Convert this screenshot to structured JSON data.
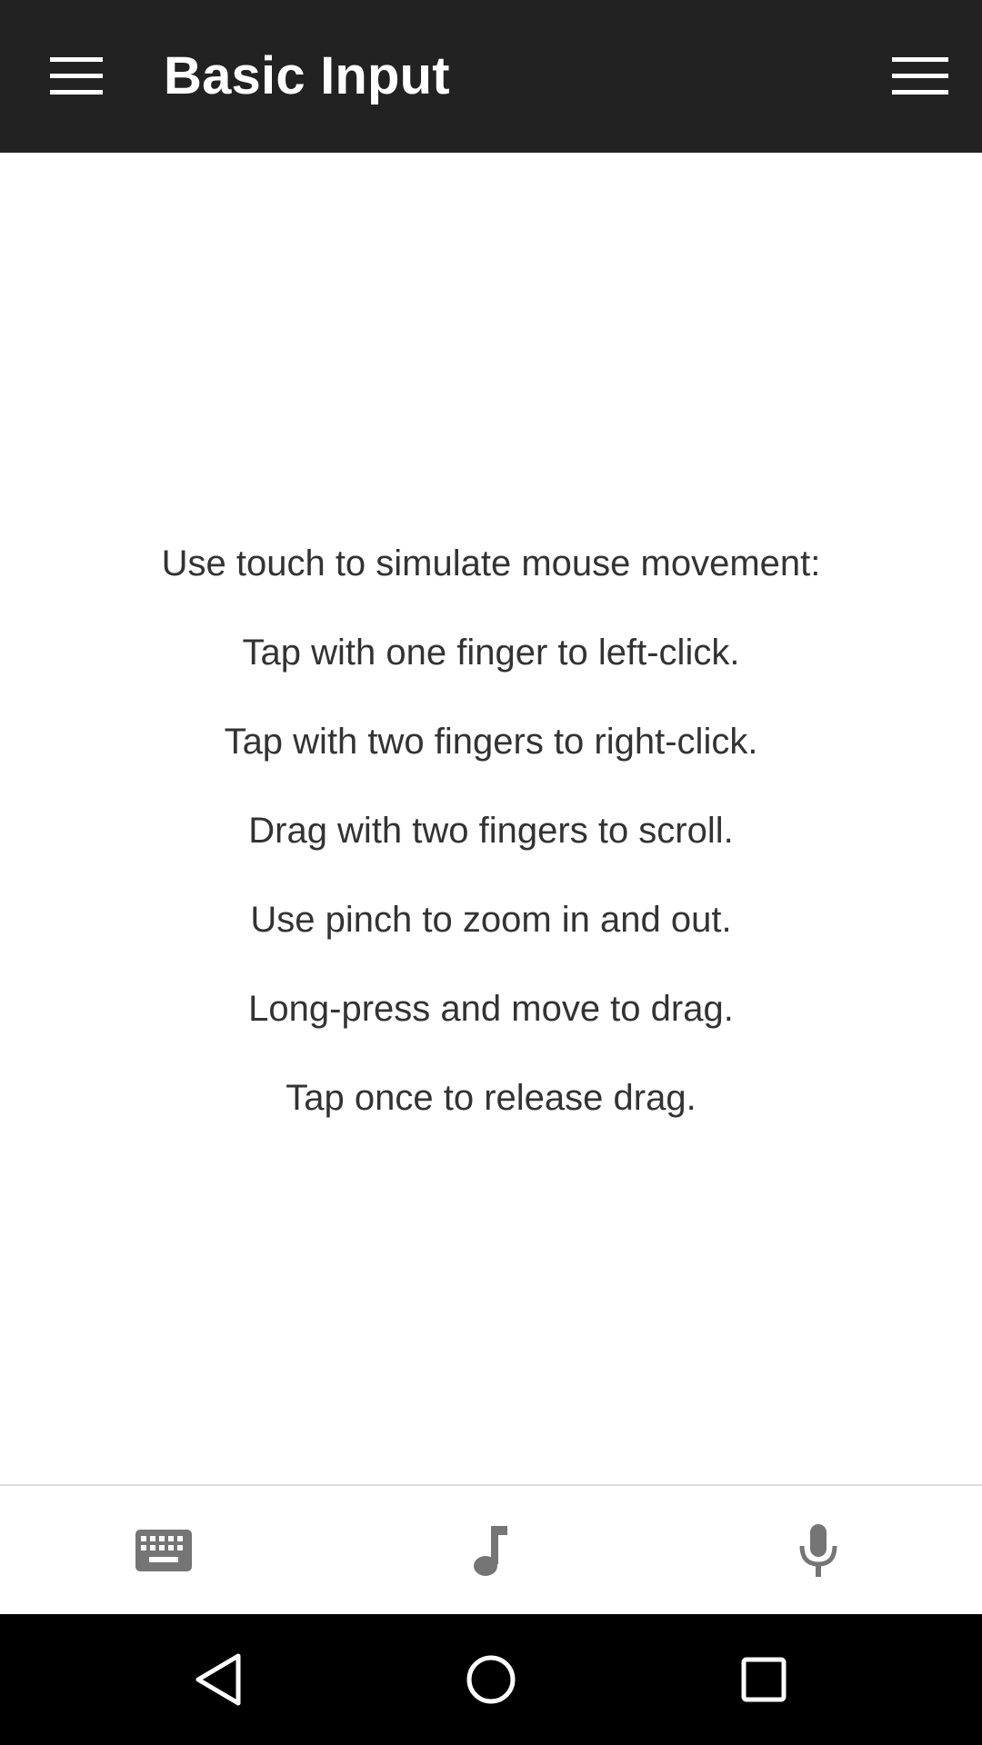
{
  "app_bar": {
    "title": "Basic Input",
    "nav_icon": "hamburger-menu-icon",
    "overflow_icon": "overflow-menu-icon",
    "background": "#222222"
  },
  "instructions": [
    "Use touch to simulate mouse movement:",
    "Tap with one finger to left-click.",
    "Tap with two fingers to right-click.",
    "Drag with two fingers to scroll.",
    "Use pinch to zoom in and out.",
    "Long-press and move to drag.",
    "Tap once to release drag."
  ],
  "bottom_toolbar": {
    "items": [
      {
        "icon": "keyboard-icon"
      },
      {
        "icon": "music-note-icon"
      },
      {
        "icon": "microphone-icon"
      }
    ],
    "icon_color": "#757575"
  },
  "system_nav": {
    "items": [
      {
        "icon": "back-icon"
      },
      {
        "icon": "home-icon"
      },
      {
        "icon": "recents-icon"
      }
    ]
  }
}
